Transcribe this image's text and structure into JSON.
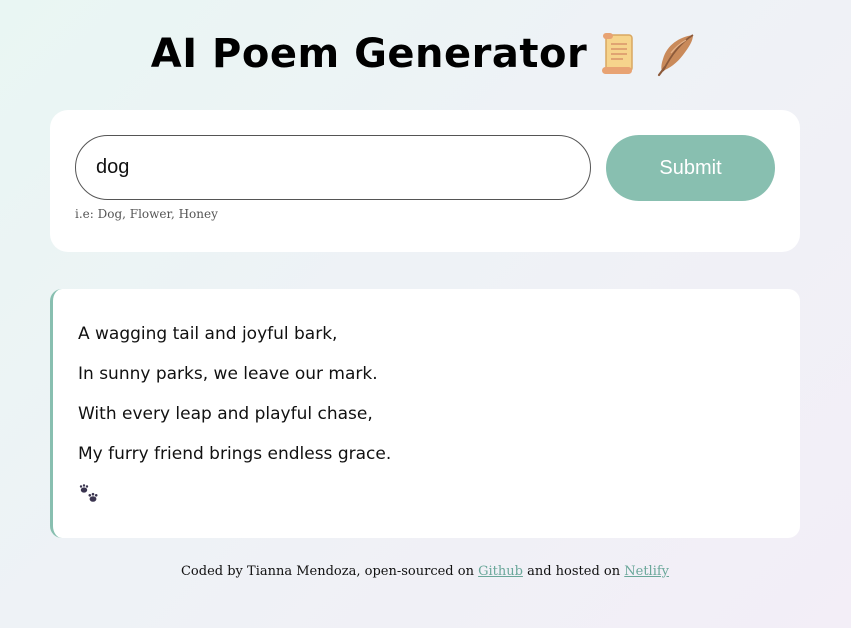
{
  "header": {
    "title": "AI Poem Generator",
    "icons": [
      "scroll-icon",
      "feather-icon"
    ]
  },
  "form": {
    "input_value": "dog",
    "hint": "i.e: Dog, Flower, Honey",
    "submit_label": "Submit"
  },
  "poem": {
    "lines": [
      "A wagging tail and joyful bark,",
      "In sunny parks, we leave our mark.",
      "With every leap and playful chase,",
      "My furry friend brings endless grace."
    ],
    "emoji_icon": "paw-prints-icon"
  },
  "footer": {
    "prefix": "Coded by Tianna Mendoza, open-sourced on",
    "github_label": "Github",
    "middle": "and hosted on",
    "netlify_label": "Netlify"
  },
  "colors": {
    "accent": "#88bfb0",
    "link": "#6aa79a",
    "card": "#ffffff"
  }
}
